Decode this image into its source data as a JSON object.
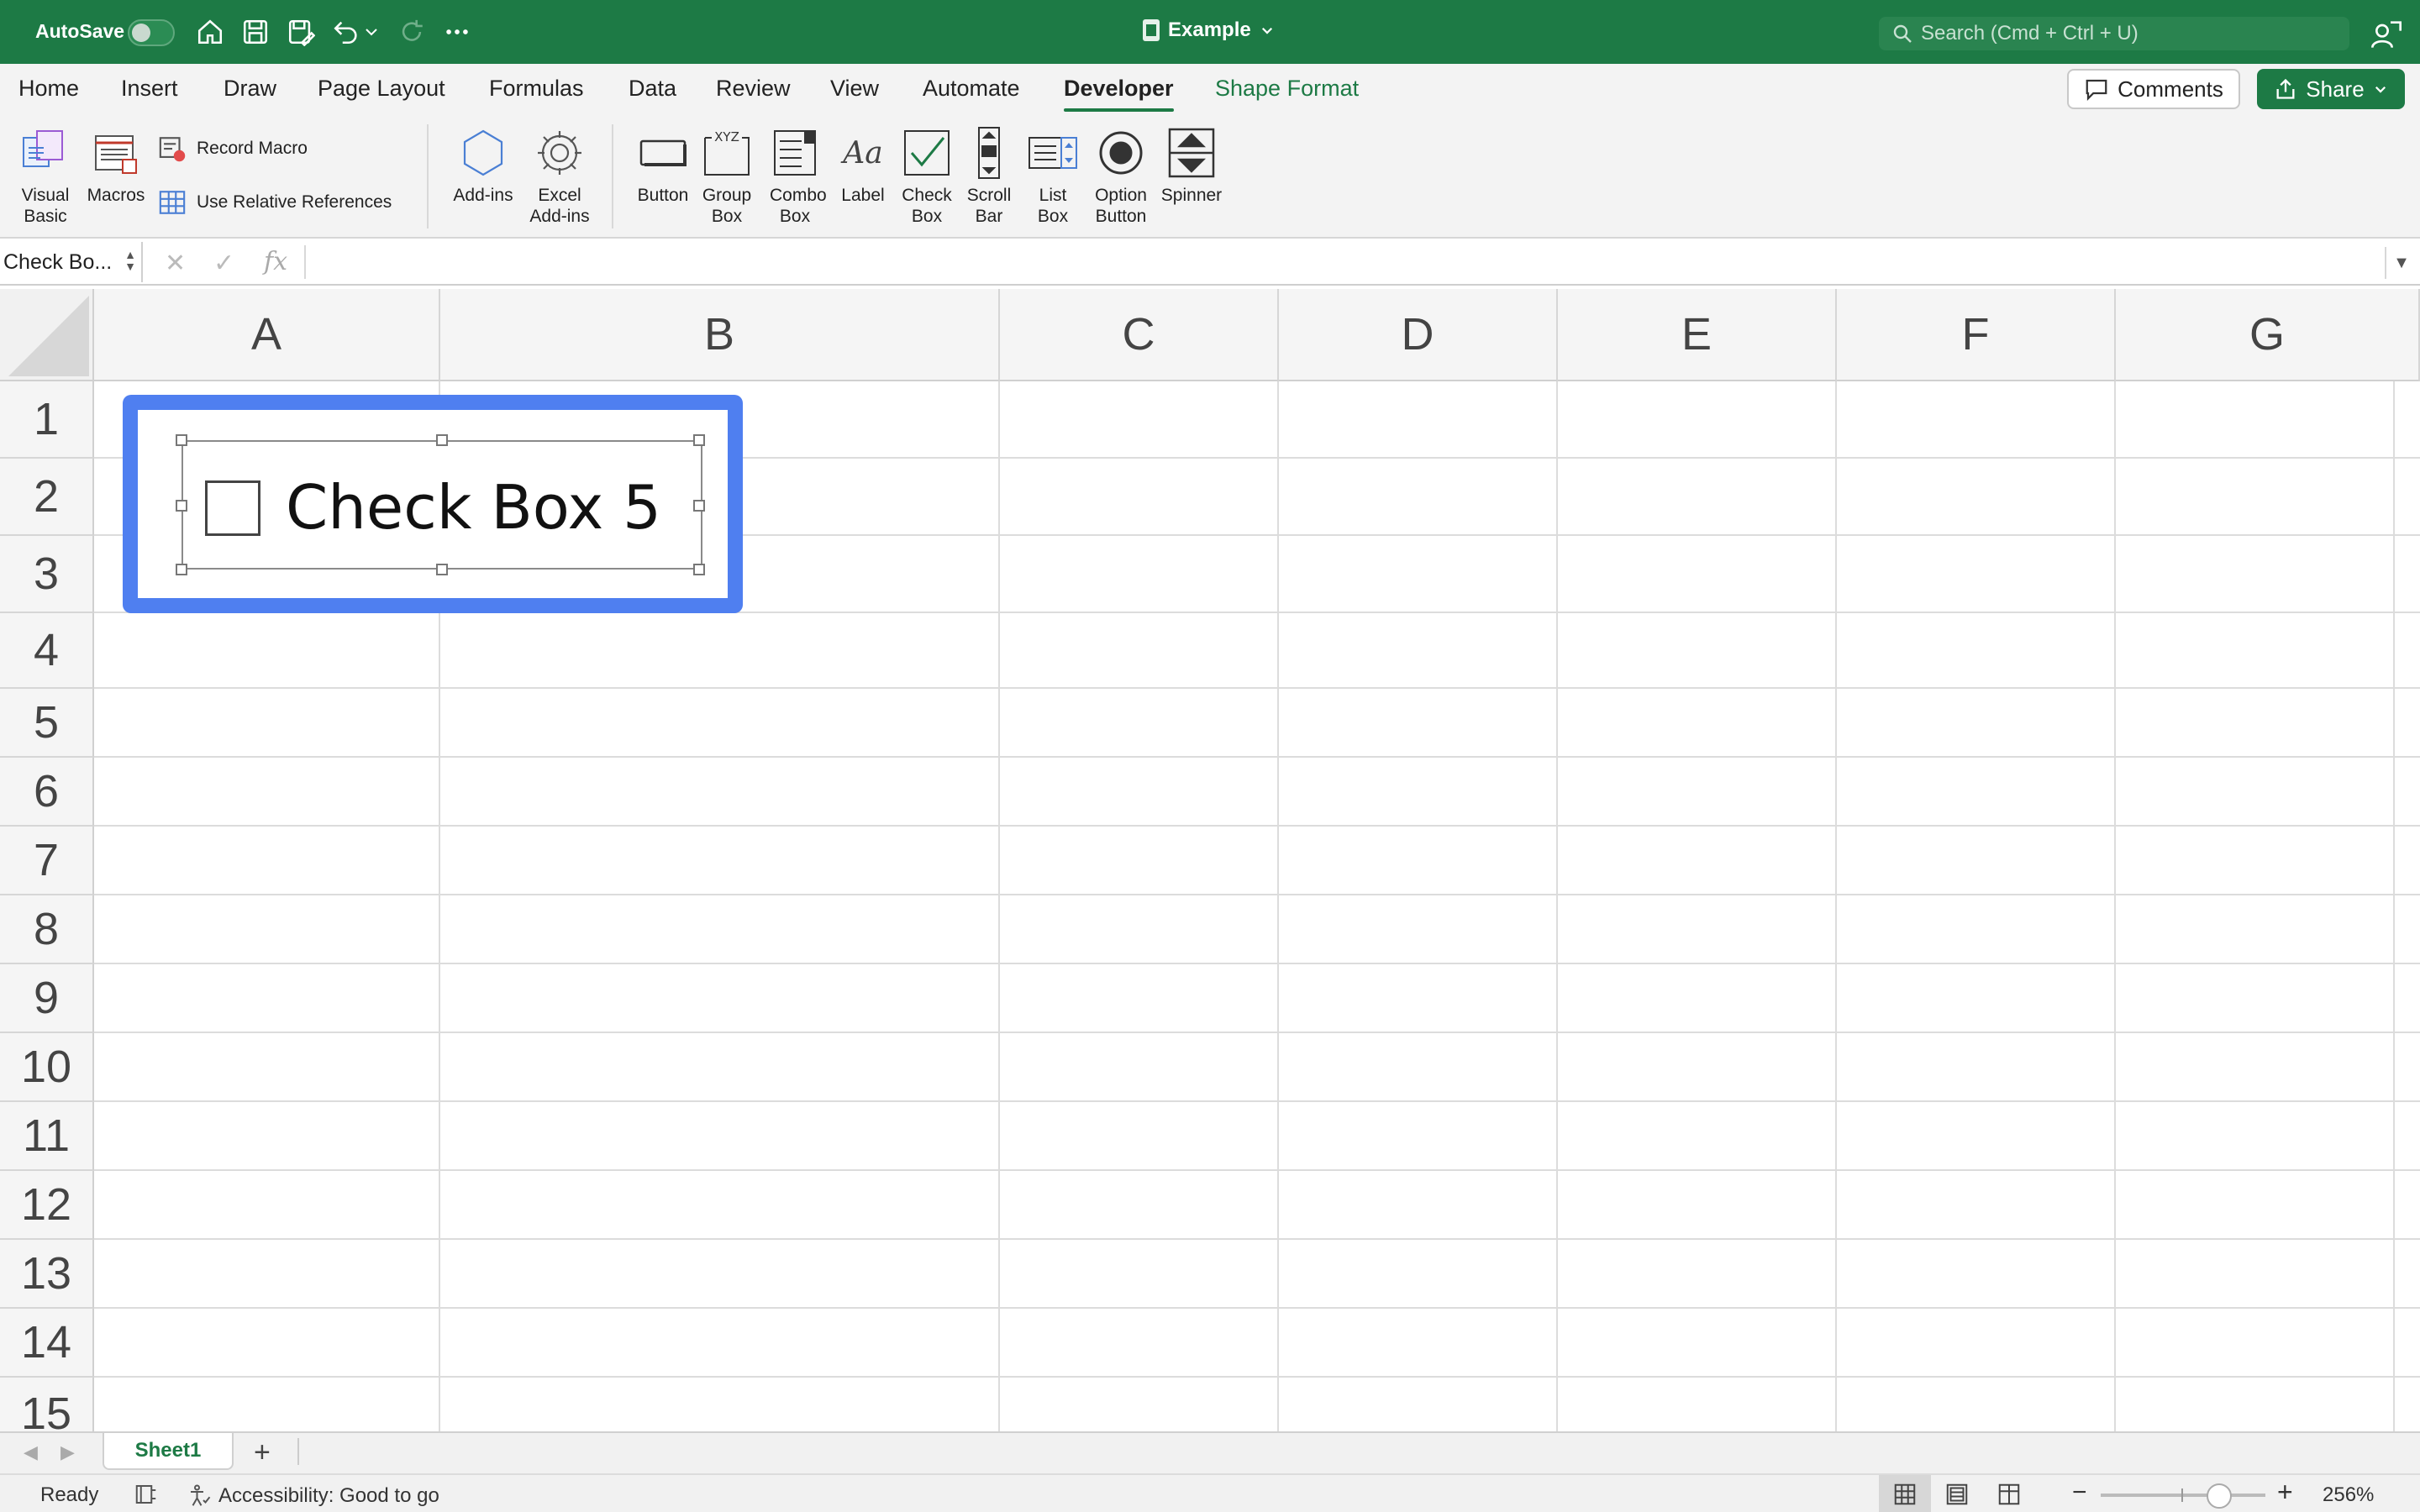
{
  "titlebar": {
    "autosave_label": "AutoSave",
    "doc_title": "Example",
    "search_placeholder": "Search (Cmd + Ctrl + U)"
  },
  "tabs": [
    "Home",
    "Insert",
    "Draw",
    "Page Layout",
    "Formulas",
    "Data",
    "Review",
    "View",
    "Automate",
    "Developer",
    "Shape Format"
  ],
  "active_tab": "Developer",
  "actions": {
    "comments": "Comments",
    "share": "Share"
  },
  "ribbon": {
    "visual_basic": "Visual Basic",
    "macros": "Macros",
    "record_macro": "Record Macro",
    "use_relative_references": "Use Relative References",
    "add_ins": "Add-ins",
    "excel_add_ins": "Excel Add-ins",
    "controls": {
      "button": "Button",
      "group_box": "Group Box",
      "combo_box": "Combo Box",
      "label": "Label",
      "check_box": "Check Box",
      "scroll_bar": "Scroll Bar",
      "list_box": "List Box",
      "option_button": "Option Button",
      "spinner": "Spinner"
    },
    "group_box_glyph": "XYZ",
    "label_glyph": "Aa"
  },
  "formula_bar": {
    "name_box": "Check Bo...",
    "fx": "fx",
    "content": ""
  },
  "columns": [
    "A",
    "B",
    "C",
    "D",
    "E",
    "F",
    "G"
  ],
  "rows": [
    "1",
    "2",
    "3",
    "4",
    "5",
    "6",
    "7",
    "8",
    "9",
    "10",
    "11",
    "12",
    "13",
    "14",
    "15"
  ],
  "checkbox_control": {
    "label": "Check Box 5",
    "checked": false
  },
  "sheets": {
    "tabs": [
      "Sheet1"
    ],
    "active": "Sheet1",
    "add": "+"
  },
  "status": {
    "ready": "Ready",
    "accessibility": "Accessibility: Good to go",
    "zoom": "256%"
  },
  "colors": {
    "brand_green": "#1d7a45",
    "selection_blue": "#4f7ff0"
  }
}
